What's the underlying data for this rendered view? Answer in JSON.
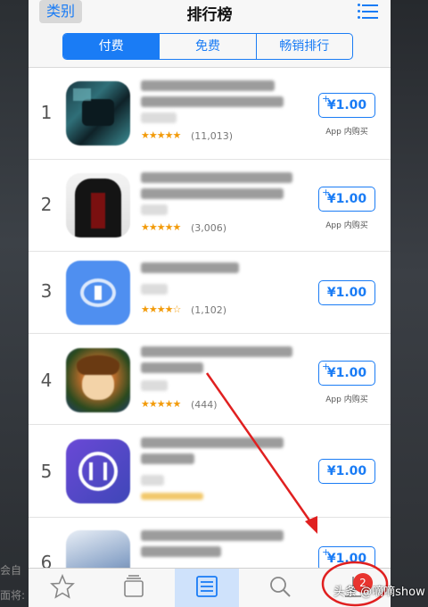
{
  "nav": {
    "left_label": "类别",
    "title": "排行榜"
  },
  "segments": [
    "付费",
    "免费",
    "畅销排行"
  ],
  "active_segment": 0,
  "apps": [
    {
      "rank": "1",
      "rating": "★★★★★",
      "reviews": "(11,013)",
      "price": "¥1.00",
      "plus": "+",
      "iap": "App 内购买"
    },
    {
      "rank": "2",
      "rating": "★★★★★",
      "reviews": "(3,006)",
      "price": "¥1.00",
      "plus": "+",
      "iap": "App 内购买"
    },
    {
      "rank": "3",
      "rating": "★★★★☆",
      "reviews": "(1,102)",
      "price": "¥1.00",
      "plus": "",
      "iap": ""
    },
    {
      "rank": "4",
      "rating": "★★★★★",
      "reviews": "(444)",
      "price": "¥1.00",
      "plus": "+",
      "iap": "App 内购买"
    },
    {
      "rank": "5",
      "rating": "",
      "reviews": "",
      "price": "¥1.00",
      "plus": "",
      "iap": ""
    },
    {
      "rank": "6",
      "rating": "",
      "reviews": "",
      "price": "¥1.00",
      "plus": "+",
      "iap": ""
    }
  ],
  "tabbar": {
    "badge": "2"
  },
  "watermark": "头条 @嘀嘀show",
  "side_texts": [
    "会自",
    "面将:"
  ],
  "colors": {
    "accent": "#1a7cf5",
    "star": "#f29b0a",
    "annotation": "#e02020"
  }
}
